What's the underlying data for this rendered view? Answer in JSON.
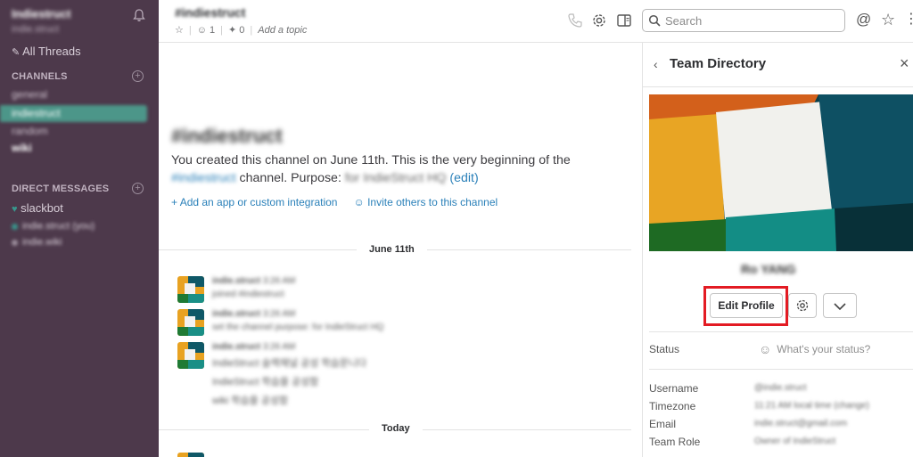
{
  "workspace": {
    "name": "Indiestruct",
    "user": "indie.struct"
  },
  "sidebar": {
    "all_threads": "All Threads",
    "channels_heading": "CHANNELS",
    "channels": [
      "general",
      "indiestruct",
      "random",
      "wiki"
    ],
    "dm_heading": "DIRECT MESSAGES",
    "dms": [
      "slackbot",
      "indie.struct (you)",
      "indie.wiki"
    ]
  },
  "header": {
    "channel": "#indiestruct",
    "members": "1",
    "pins": "0",
    "topic_placeholder": "Add a topic",
    "search_placeholder": "Search"
  },
  "main": {
    "title": "#indiestruct",
    "intro_prefix": "You created this channel on June 11th. This is the very beginning of the",
    "intro_channel": "#indiestruct",
    "intro_mid": "channel. Purpose:",
    "intro_purpose": "for IndieStruct HQ",
    "intro_edit": "(edit)",
    "add_app": "Add an app or custom integration",
    "invite": "Invite others to this channel",
    "day1": "June 11th",
    "day2": "Today",
    "messages": [
      {
        "author": "indie.struct",
        "time": "3:26 AM",
        "text": "joined #indiestruct"
      },
      {
        "author": "indie.struct",
        "time": "3:26 AM",
        "text": "set the channel purpose: for IndieStruct HQ"
      },
      {
        "author": "indie.struct",
        "time": "3:26 AM",
        "text": "IndieStruct 슬랙채널 공성 학습문니다"
      }
    ],
    "extra_lines": [
      "IndieStruct 학습을 공성함",
      "wiki 학습을 공성함"
    ]
  },
  "panel": {
    "title": "Team Directory",
    "profile_name": "Ro YANG",
    "edit_button": "Edit Profile",
    "status_label": "Status",
    "status_placeholder": "What's your status?",
    "fields": [
      {
        "label": "Username",
        "value": "@indie.struct"
      },
      {
        "label": "Timezone",
        "value": "11:21 AM local time (change)"
      },
      {
        "label": "Email",
        "value": "indie.struct@gmail.com"
      },
      {
        "label": "Team Role",
        "value": "Owner of IndieStruct"
      }
    ]
  },
  "colors": {
    "sidebar": "#4d394b",
    "active_channel": "#4c9689",
    "link": "#2a80b9",
    "highlight": "#e31b23"
  }
}
